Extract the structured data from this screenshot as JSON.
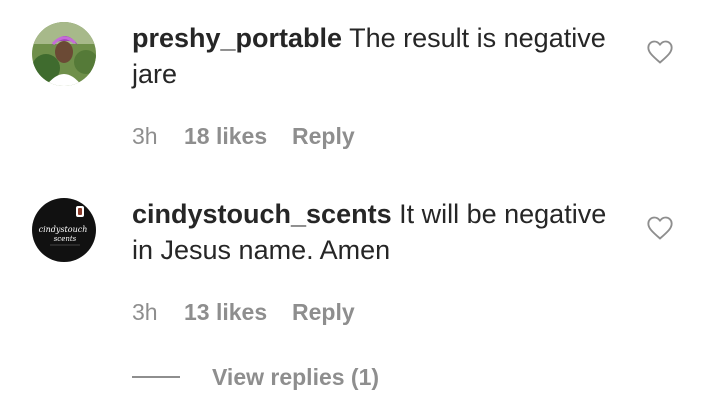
{
  "comments": [
    {
      "username": "preshy_portable",
      "text": " The result is negative jare",
      "time": "3h",
      "likes": "18 likes",
      "reply": "Reply",
      "avatar_icon": "profile-photo",
      "like_icon": "heart-outline-icon"
    },
    {
      "username": "cindystouch_scents",
      "text": " It will be negative in Jesus name. Amen",
      "time": "3h",
      "likes": "13 likes",
      "reply": "Reply",
      "avatar_icon": "brand-logo",
      "avatar_logo_text": "cindystouch scents",
      "like_icon": "heart-outline-icon"
    }
  ],
  "view_replies": "View replies (1)",
  "colors": {
    "text": "#262626",
    "muted": "#8e8e8e",
    "background": "#ffffff"
  }
}
